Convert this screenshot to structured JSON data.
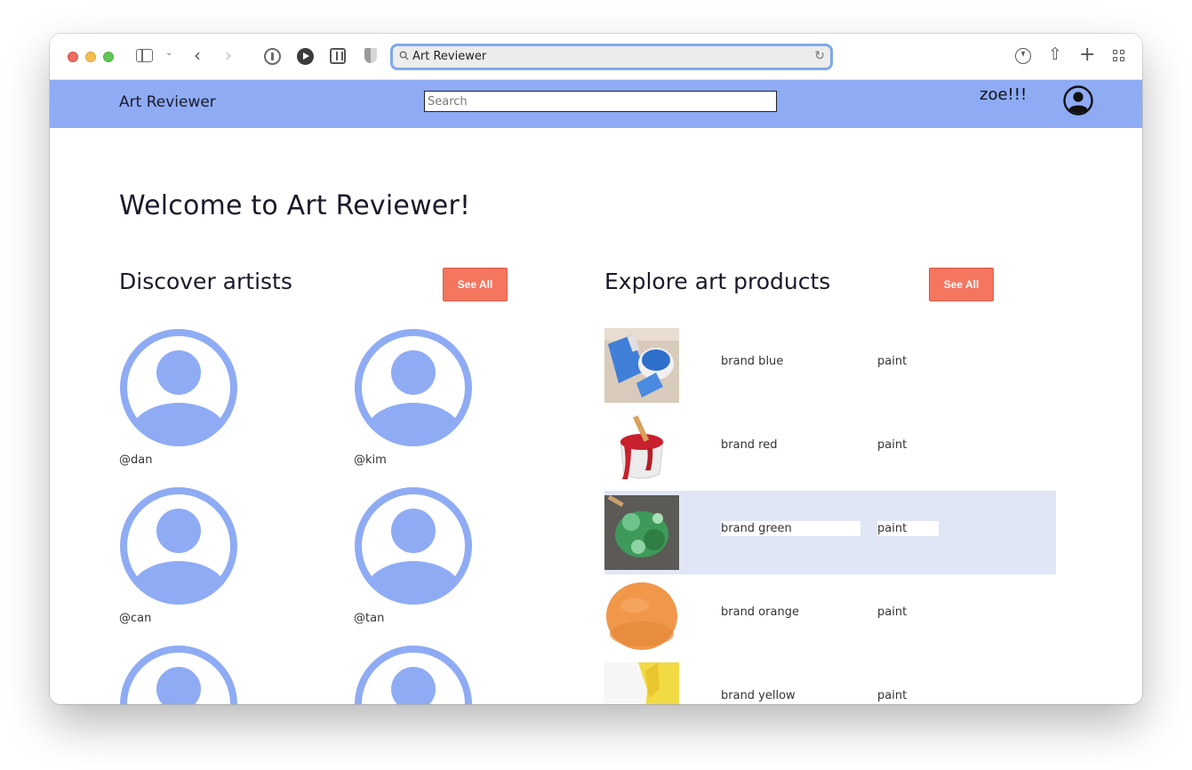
{
  "browser": {
    "url_text": "Art Reviewer"
  },
  "header": {
    "brand": "Art Reviewer",
    "search_placeholder": "Search",
    "username": "zoe!!!"
  },
  "main": {
    "welcome": "Welcome to Art Reviewer!",
    "artists": {
      "title": "Discover artists",
      "see_all_label": "See All",
      "items": [
        {
          "handle": "@dan"
        },
        {
          "handle": "@kim"
        },
        {
          "handle": "@can"
        },
        {
          "handle": "@tan"
        },
        {
          "handle": ""
        },
        {
          "handle": ""
        }
      ]
    },
    "products": {
      "title": "Explore art products",
      "see_all_label": "See All",
      "items": [
        {
          "name": "brand blue",
          "type": "paint",
          "color": "#3f7fd8"
        },
        {
          "name": "brand red",
          "type": "paint",
          "color": "#c8202c"
        },
        {
          "name": "brand green",
          "type": "paint",
          "color": "#3e9a5a"
        },
        {
          "name": "brand orange",
          "type": "paint",
          "color": "#f0974a"
        },
        {
          "name": "brand yellow",
          "type": "paint",
          "color": "#f2da45"
        }
      ]
    }
  },
  "colors": {
    "header_bg": "#8eabf4",
    "accent_button": "#f4765f",
    "avatar": "#8eabf4",
    "row_highlight": "#e0e6f5"
  }
}
